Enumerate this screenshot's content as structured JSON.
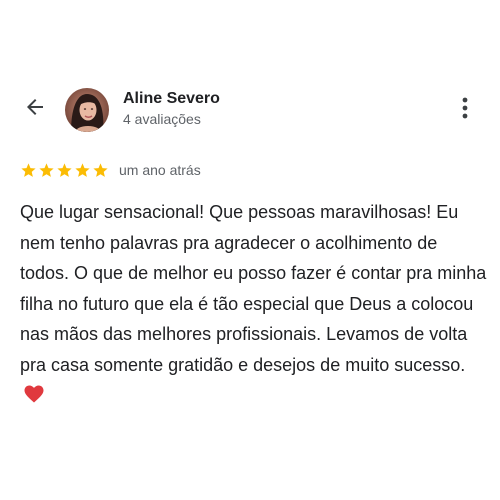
{
  "header": {
    "back_icon": "arrow-left-icon",
    "more_icon": "more-vertical-icon",
    "avatar_icon": "user-avatar"
  },
  "reviewer": {
    "name": "Aline Severo",
    "review_count": "4 avaliações"
  },
  "review": {
    "rating": 5,
    "rating_max": 5,
    "star_color": "#fbbc04",
    "date": "um ano atrás",
    "text": "Que lugar sensacional! Que pessoas maravilhosas! Eu nem tenho palavras pra agradecer o acolhimento de todos. O que de melhor eu posso fazer é contar pra minha filha no futuro que ela é tão especial que Deus a colocou nas mãos das melhores profissionais. Levamos de volta pra casa somente gratidão e desejos de muito sucesso.",
    "emoji_icon": "red-heart-icon",
    "emoji_color": "#e0393e"
  }
}
